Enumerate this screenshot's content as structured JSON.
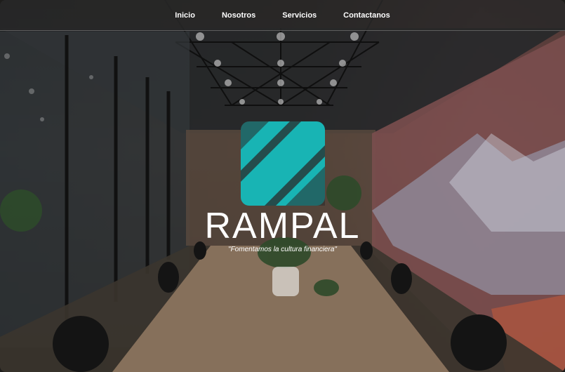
{
  "nav": {
    "items": [
      {
        "label": "Inicio"
      },
      {
        "label": "Nosotros"
      },
      {
        "label": "Servicios"
      },
      {
        "label": "Contactanos"
      }
    ]
  },
  "hero": {
    "brand": "RAMPAL",
    "tagline": "\"Fomentamos la cultura financiera\"",
    "logo_color": "#18b4b4"
  }
}
